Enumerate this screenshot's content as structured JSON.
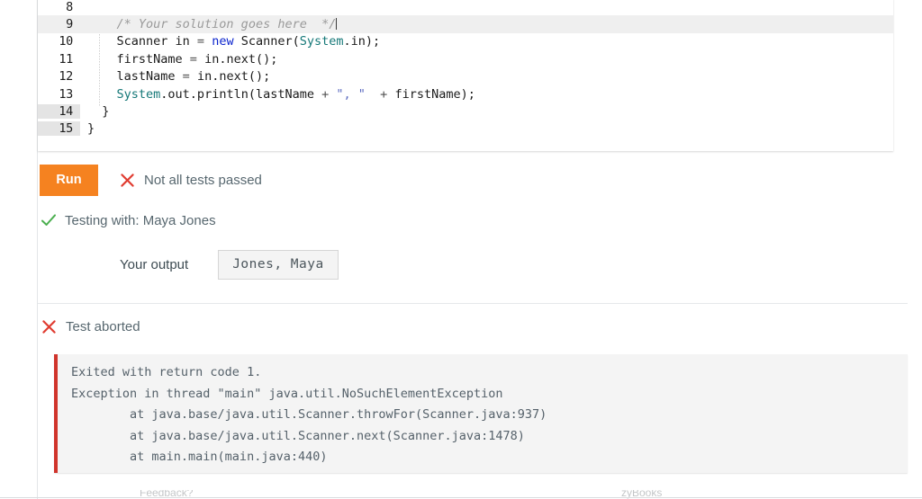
{
  "editor": {
    "lines": [
      {
        "number": "8",
        "active": false,
        "gutter_shaded": false,
        "segments": [
          {
            "t": "",
            "c": "plain"
          }
        ]
      },
      {
        "number": "9",
        "active": true,
        "gutter_shaded": false,
        "segments": [
          {
            "t": "    ",
            "c": "plain"
          },
          {
            "t": "/* Your solution goes here  */",
            "c": "comment"
          }
        ]
      },
      {
        "number": "10",
        "active": false,
        "gutter_shaded": false,
        "segments": [
          {
            "t": "    Scanner in ",
            "c": "plain"
          },
          {
            "t": "=",
            "c": "op"
          },
          {
            "t": " ",
            "c": "plain"
          },
          {
            "t": "new",
            "c": "kw"
          },
          {
            "t": " Scanner(",
            "c": "plain"
          },
          {
            "t": "System",
            "c": "type"
          },
          {
            "t": ".in);",
            "c": "plain"
          }
        ]
      },
      {
        "number": "11",
        "active": false,
        "gutter_shaded": false,
        "segments": [
          {
            "t": "    firstName ",
            "c": "plain"
          },
          {
            "t": "=",
            "c": "op"
          },
          {
            "t": " in.next();",
            "c": "plain"
          }
        ]
      },
      {
        "number": "12",
        "active": false,
        "gutter_shaded": false,
        "segments": [
          {
            "t": "    lastName ",
            "c": "plain"
          },
          {
            "t": "=",
            "c": "op"
          },
          {
            "t": " in.next();",
            "c": "plain"
          }
        ]
      },
      {
        "number": "13",
        "active": false,
        "gutter_shaded": false,
        "segments": [
          {
            "t": "    ",
            "c": "plain"
          },
          {
            "t": "System",
            "c": "type"
          },
          {
            "t": ".out.println(lastName ",
            "c": "plain"
          },
          {
            "t": "+",
            "c": "op"
          },
          {
            "t": " ",
            "c": "plain"
          },
          {
            "t": "\", \"",
            "c": "str"
          },
          {
            "t": "  ",
            "c": "plain"
          },
          {
            "t": "+",
            "c": "op"
          },
          {
            "t": " firstName);",
            "c": "plain"
          }
        ]
      },
      {
        "number": "14",
        "active": false,
        "gutter_shaded": true,
        "segments": [
          {
            "t": "  }",
            "c": "plain"
          }
        ]
      },
      {
        "number": "15",
        "active": false,
        "gutter_shaded": true,
        "segments": [
          {
            "t": "}",
            "c": "plain"
          }
        ]
      }
    ]
  },
  "toolbar": {
    "run_label": "Run",
    "run_color": "#f58220",
    "status_label": "Not all tests passed",
    "status_icon": "x-icon",
    "status_icon_color": "#e03c31"
  },
  "testing": {
    "icon": "check-icon",
    "icon_color": "#4caf50",
    "label": "Testing with: Maya Jones"
  },
  "output": {
    "label": "Your output",
    "value": "Jones, Maya"
  },
  "aborted": {
    "icon": "x-icon",
    "icon_color": "#e03c31",
    "label": "Test aborted"
  },
  "error": {
    "accent_color": "#d0342c",
    "lines": [
      "Exited with return code 1.",
      "Exception in thread \"main\" java.util.NoSuchElementException",
      "        at java.base/java.util.Scanner.throwFor(Scanner.java:937)",
      "        at java.base/java.util.Scanner.next(Scanner.java:1478)",
      "        at main.main(main.java:440)"
    ]
  },
  "clipped_bottom": {
    "left_text": "Feedback?",
    "right_text": "zyBooks"
  }
}
